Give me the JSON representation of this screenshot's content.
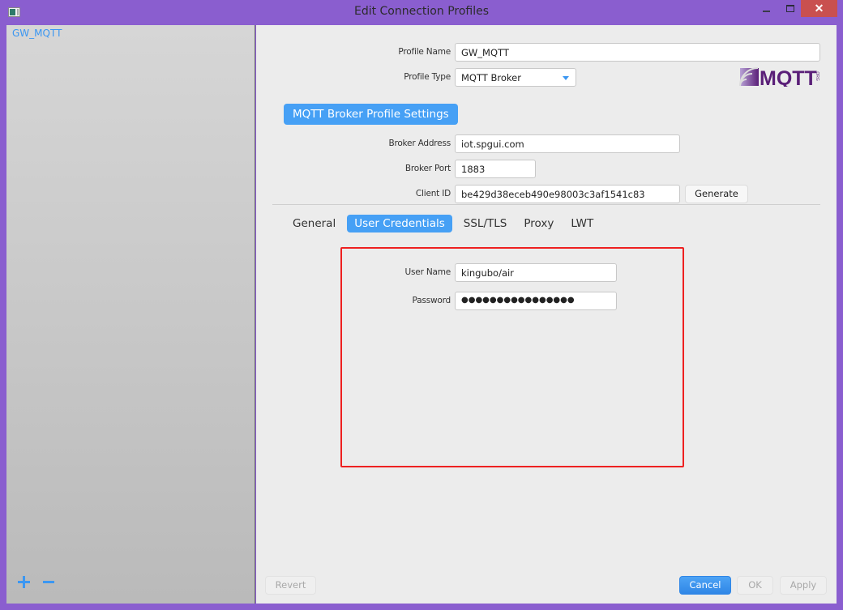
{
  "window": {
    "title": "Edit Connection Profiles",
    "controls": {
      "minimize": "minimize",
      "maximize": "maximize",
      "close": "✕"
    }
  },
  "sidebar": {
    "profiles": [
      {
        "label": "GW_MQTT",
        "selected": true
      }
    ],
    "add_label": "+",
    "remove_label": "−"
  },
  "profile": {
    "name_label": "Profile Name",
    "name_value": "GW_MQTT",
    "type_label": "Profile Type",
    "type_value": "MQTT Broker",
    "logo_text": "MQTT",
    "logo_suffix": ".ORG"
  },
  "broker": {
    "section_title": "MQTT Broker Profile Settings",
    "address_label": "Broker Address",
    "address_value": "iot.spgui.com",
    "port_label": "Broker Port",
    "port_value": "1883",
    "client_id_label": "Client ID",
    "client_id_value": "be429d38eceb490e98003c3af1541c83",
    "generate_label": "Generate"
  },
  "tabs": [
    {
      "label": "General",
      "active": false
    },
    {
      "label": "User Credentials",
      "active": true
    },
    {
      "label": "SSL/TLS",
      "active": false
    },
    {
      "label": "Proxy",
      "active": false
    },
    {
      "label": "LWT",
      "active": false
    }
  ],
  "credentials": {
    "username_label": "User Name",
    "username_value": "kingubo/air",
    "password_label": "Password",
    "password_value": "●●●●●●●●●●●●●●●●"
  },
  "footer": {
    "revert_label": "Revert",
    "cancel_label": "Cancel",
    "ok_label": "OK",
    "apply_label": "Apply"
  },
  "colors": {
    "accent": "#46a0f5",
    "titlebar": "#8a5ecf",
    "close": "#c9504f",
    "highlight": "#ee2020"
  }
}
